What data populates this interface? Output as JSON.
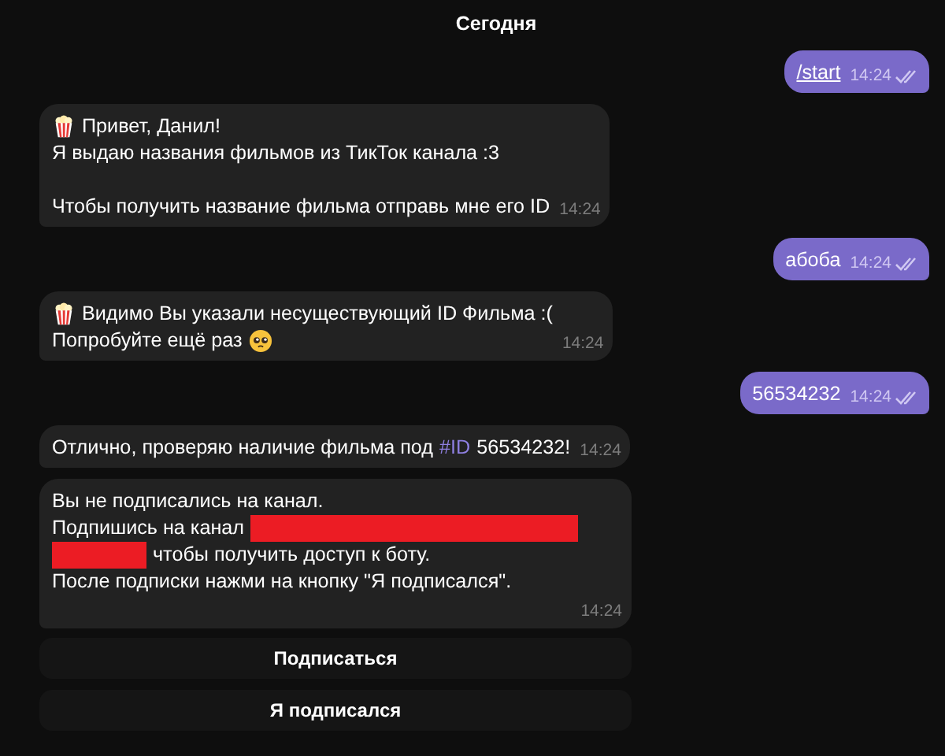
{
  "date_label": "Сегодня",
  "messages": [
    {
      "outgoing": true,
      "read": true,
      "time": "14:24",
      "paragraphs": [
        [
          [
            {
              "kind": "command",
              "text": "/start"
            }
          ]
        ]
      ]
    },
    {
      "outgoing": false,
      "time": "14:24",
      "paragraphs": [
        [
          [
            {
              "kind": "popcorn"
            },
            {
              "kind": "text",
              "text": "Привет, Данил!"
            }
          ],
          [
            {
              "kind": "text",
              "text": "Я выдаю названия фильмов из ТикТок канала :3"
            }
          ]
        ],
        [
          [
            {
              "kind": "text",
              "text": "Чтобы получить название фильма отправь мне его ID"
            }
          ]
        ]
      ]
    },
    {
      "outgoing": true,
      "read": true,
      "time": "14:24",
      "paragraphs": [
        [
          [
            {
              "kind": "text",
              "text": "абоба"
            }
          ]
        ]
      ]
    },
    {
      "outgoing": false,
      "time": "14:24",
      "paragraphs": [
        [
          [
            {
              "kind": "popcorn"
            },
            {
              "kind": "text",
              "text": "Видимо Вы указали несуществующий ID Фильма :("
            }
          ],
          [
            {
              "kind": "text",
              "text": "Попробуйте ещё раз"
            },
            {
              "kind": "pleading"
            }
          ]
        ]
      ]
    },
    {
      "outgoing": true,
      "read": true,
      "time": "14:24",
      "paragraphs": [
        [
          [
            {
              "kind": "text",
              "text": "56534232"
            }
          ]
        ]
      ]
    },
    {
      "outgoing": false,
      "time": "14:24",
      "paragraphs": [
        [
          [
            {
              "kind": "text",
              "text": "Отлично, проверяю наличие фильма под"
            },
            {
              "kind": "hashtag",
              "text": "#ID"
            },
            {
              "kind": "text",
              "text": "56534232!"
            }
          ]
        ]
      ]
    },
    {
      "outgoing": false,
      "time": "14:24",
      "paragraphs": [
        [
          [
            {
              "kind": "text",
              "text": "Вы не подписались на канал."
            }
          ],
          [
            {
              "kind": "text",
              "text": "Подпишись на канал"
            },
            {
              "kind": "redacted"
            }
          ],
          [
            {
              "kind": "redacted_short"
            },
            {
              "kind": "text",
              "text": "чтобы получить доступ к боту."
            }
          ],
          [
            {
              "kind": "text",
              "text": "После подписки нажми на кнопку \"Я подписался\"."
            }
          ]
        ]
      ]
    }
  ],
  "inline_buttons": [
    "Подписаться",
    "Я подписался"
  ]
}
